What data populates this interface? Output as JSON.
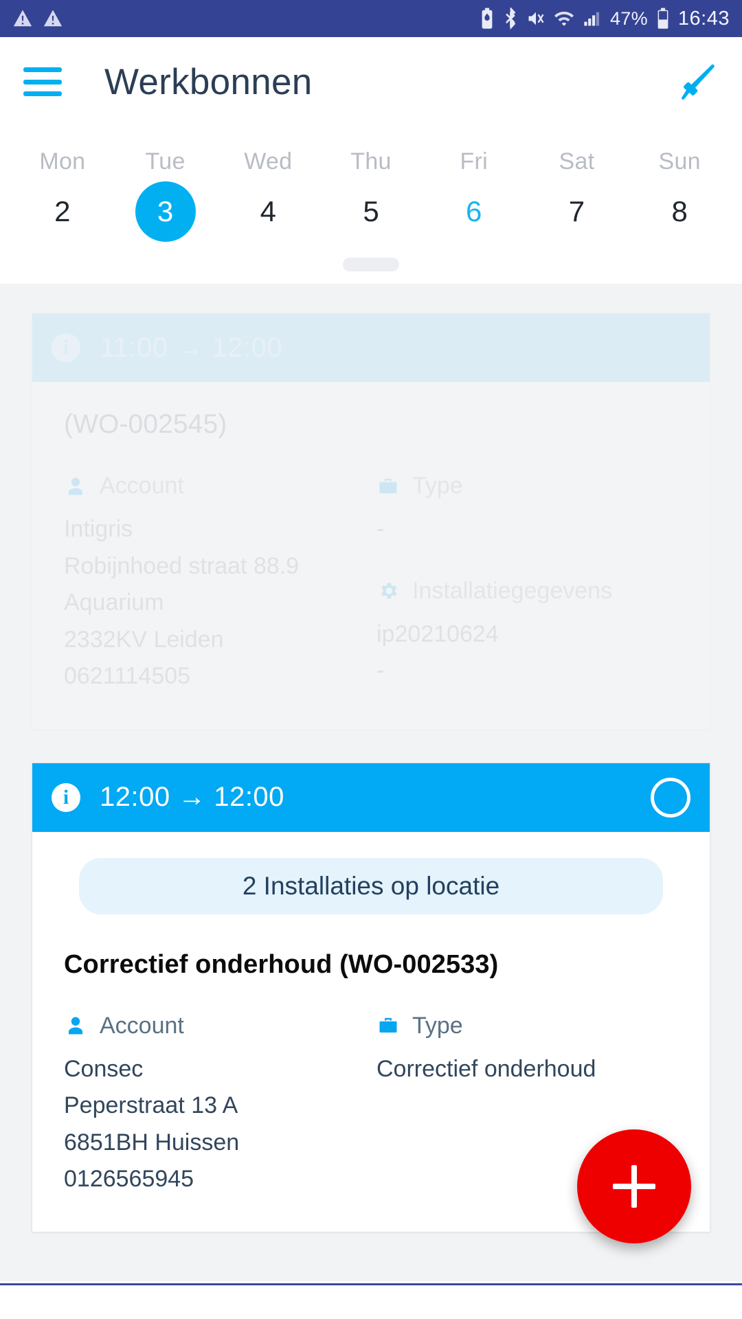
{
  "status_bar": {
    "left_icons": [
      "warning-icon",
      "warning-icon"
    ],
    "right_icons": [
      "battery-saver-icon",
      "bluetooth-icon",
      "volume-mute-icon",
      "wifi-icon",
      "cellular-signal-icon"
    ],
    "battery_percent": "47%",
    "time": "16:43",
    "background": "#354394"
  },
  "app_bar": {
    "menu_icon": "hamburger-menu-icon",
    "title": "Werkbonnen",
    "action_icon": "megaphone-icon",
    "accent": "#00b0f0",
    "title_color": "#2c3e55"
  },
  "week_strip": {
    "days": [
      {
        "name": "Mon",
        "date": "2",
        "selected": false,
        "today": false
      },
      {
        "name": "Tue",
        "date": "3",
        "selected": true,
        "today": false
      },
      {
        "name": "Wed",
        "date": "4",
        "selected": false,
        "today": false
      },
      {
        "name": "Thu",
        "date": "5",
        "selected": false,
        "today": false
      },
      {
        "name": "Fri",
        "date": "6",
        "selected": false,
        "today": true
      },
      {
        "name": "Sat",
        "date": "7",
        "selected": false,
        "today": false
      },
      {
        "name": "Sun",
        "date": "8",
        "selected": false,
        "today": false
      }
    ],
    "selected_bg": "#02b0f1",
    "today_color": "#14b5f0",
    "drag_handle": "drag-handle"
  },
  "cards": [
    {
      "state": "faded",
      "header": {
        "icon": "info-icon",
        "time_range": "11:00 → 12:00",
        "background": "#addff7",
        "has_status_circle": false
      },
      "badge": null,
      "title": "(WO-002545)",
      "left_field": {
        "icon": "person-icon",
        "label": "Account",
        "lines": [
          "Intigris",
          "Robijnhoed straat 88.9",
          "Aquarium",
          "2332KV Leiden",
          "0621114505"
        ]
      },
      "right_field": {
        "icon": "briefcase-icon",
        "label": "Type",
        "lines": [
          "-"
        ]
      },
      "right_field_2": {
        "icon": "gear-icon",
        "label": "Installatiegegevens",
        "lines": [
          "ip20210624",
          "-"
        ]
      }
    },
    {
      "state": "active",
      "header": {
        "icon": "info-icon",
        "time_range": "12:00 → 12:00",
        "background": "#02a9f4",
        "has_status_circle": true,
        "status_circle": "status-circle-empty"
      },
      "badge": "2 Installaties op locatie",
      "title": "Correctief onderhoud (WO-002533)",
      "left_field": {
        "icon": "person-icon",
        "label": "Account",
        "lines": [
          "Consec",
          "Peperstraat 13 A",
          "6851BH Huissen",
          "0126565945"
        ]
      },
      "right_field": {
        "icon": "briefcase-icon",
        "label": "Type",
        "lines": [
          "Correctief onderhoud"
        ]
      },
      "right_field_2": null
    }
  ],
  "fab": {
    "icon": "plus-icon",
    "color": "#ee0000"
  }
}
